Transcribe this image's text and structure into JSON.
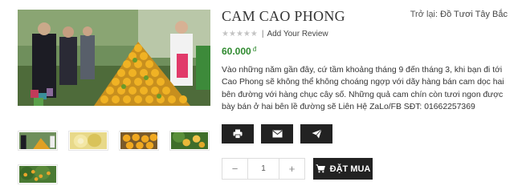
{
  "product": {
    "title": "CAM CAO PHONG",
    "back_label": "Trở lại:",
    "back_link": "Đồ Tươi Tây Bắc",
    "rating": {
      "stars": 0,
      "max": 5,
      "separator": "|",
      "add_review": "Add Your Review"
    },
    "price": {
      "value": "60.000",
      "currency": "đ"
    },
    "description": "Vào những năm gần đây, cứ tầm khoảng tháng 9 đến tháng 3, khi bạn đi tới Cao Phong sẽ không thể không choáng ngợp với dãy hàng bán cam dọc hai bên đường với hàng chục cây số. Những quả cam chín còn tươi ngon được bày bán ở hai bên lề đường sẽ Liên Hệ ZaLo/FB SĐT: 01662257369"
  },
  "gallery": {
    "main_image": "orange-market-photo",
    "thumbnails": [
      "orange-market-photo",
      "sliced-orange-photo",
      "orange-pile-photo",
      "orange-tree-photo",
      "orange-grove-photo"
    ]
  },
  "share_buttons": [
    {
      "icon": "print-icon"
    },
    {
      "icon": "envelope-icon"
    },
    {
      "icon": "paper-plane-icon"
    }
  ],
  "cart": {
    "minus": "−",
    "plus": "+",
    "quantity": "1",
    "buy_label": "ĐẶT MUA",
    "buy_icon": "shopping-cart-icon"
  },
  "colors": {
    "price": "#2f8a2f",
    "button_bg": "#222222",
    "star": "#c4c4c4"
  }
}
